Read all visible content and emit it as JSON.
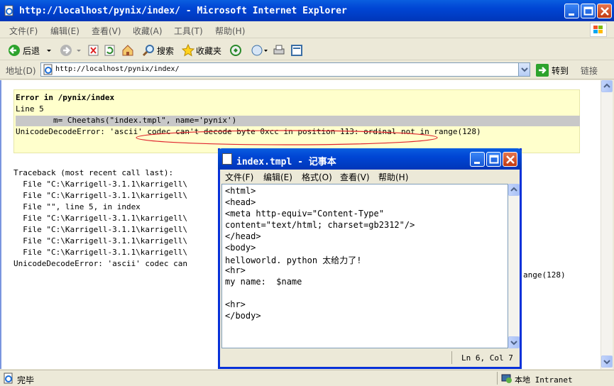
{
  "ie": {
    "title": "http://localhost/pynix/index/ - Microsoft Internet Explorer",
    "menu": [
      "文件(F)",
      "编辑(E)",
      "查看(V)",
      "收藏(A)",
      "工具(T)",
      "帮助(H)"
    ],
    "toolbar": {
      "back_label": "后退",
      "search_label": "搜索",
      "favorites_label": "收藏夹"
    },
    "address": {
      "label": "地址(D)",
      "url": "http://localhost/pynix/index/",
      "go_label": "转到",
      "links_label": "链接"
    },
    "status": {
      "text": "完毕",
      "zone": "本地 Intranet"
    }
  },
  "page": {
    "error_box": {
      "heading": "Error in /pynix/index",
      "line": "Line 5",
      "code": "        m= Cheetahs(\"index.tmpl\", name='pynix')",
      "message": "UnicodeDecodeError: 'ascii' codec can't decode byte 0xcc in position 113: ordinal not in range(128)"
    },
    "traceback": [
      "Traceback (most recent call last):",
      "  File \"C:\\Karrigell-3.1.1\\karrigell\\",
      "  File \"C:\\Karrigell-3.1.1\\karrigell\\",
      "  File \"\", line 5, in index",
      "  File \"C:\\Karrigell-3.1.1\\karrigell\\",
      "  File \"C:\\Karrigell-3.1.1\\karrigell\\",
      "  File \"C:\\Karrigell-3.1.1\\karrigell\\",
      "  File \"C:\\Karrigell-3.1.1\\karrigell\\",
      "UnicodeDecodeError: 'ascii' codec can",
      "ange(128)"
    ]
  },
  "notepad": {
    "title": "index.tmpl - 记事本",
    "menu": [
      "文件(F)",
      "编辑(E)",
      "格式(O)",
      "查看(V)",
      "帮助(H)"
    ],
    "lines": [
      "<html>",
      "<head>",
      "<meta http-equiv=\"Content-Type\"",
      "content=\"text/html; charset=gb2312\"/>",
      "</head>",
      "<body>",
      "helloworld. python 太给力了!",
      "<hr>",
      "my name:  $name",
      "",
      "<hr>",
      "</body>"
    ],
    "status_pos": "Ln 6, Col 7"
  }
}
